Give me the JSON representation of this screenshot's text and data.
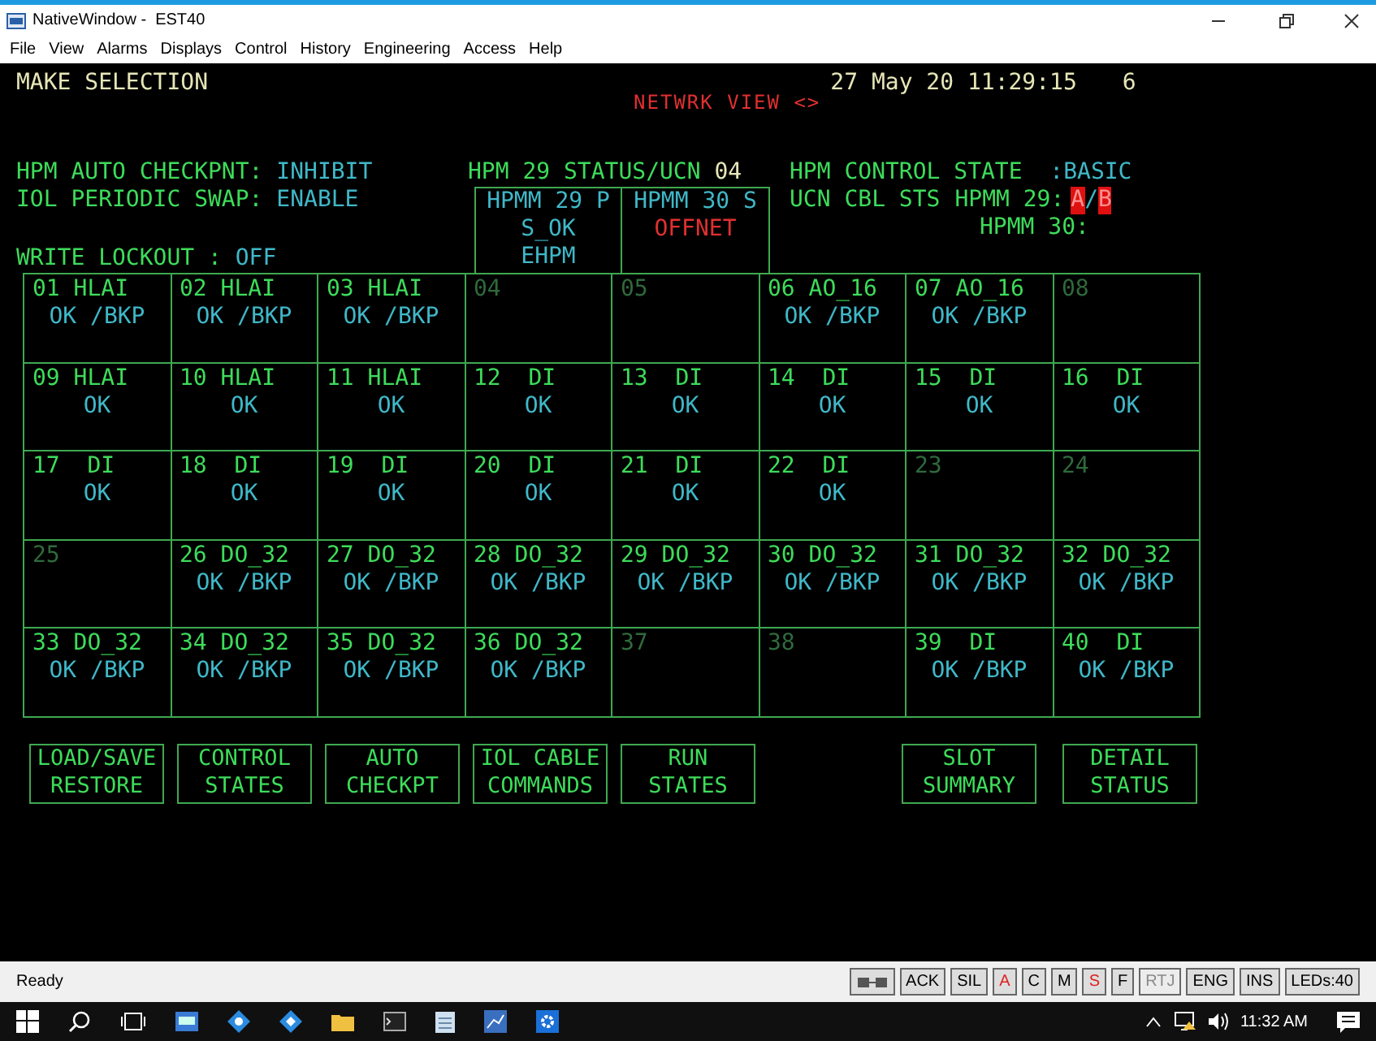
{
  "window": {
    "title": "NativeWindow -  EST40"
  },
  "menu": [
    "File",
    "View",
    "Alarms",
    "Displays",
    "Control",
    "History",
    "Engineering",
    "Access",
    "Help"
  ],
  "display": {
    "prompt": "MAKE SELECTION",
    "view_title": "NETWRK VIEW <>",
    "datetime": "27 May 20 11:29:15",
    "console_number": "6",
    "settings": [
      {
        "label": "HPM AUTO CHECKPNT:",
        "value": "INHIBIT"
      },
      {
        "label": "IOL PERIODIC SWAP:",
        "value": "ENABLE"
      },
      {
        "label": "WRITE LOCKOUT :",
        "value": "OFF"
      }
    ],
    "hpm_status": {
      "label": "HPM 29 STATUS/UCN",
      "ucn": "04",
      "hpmm": [
        {
          "title": "HPMM 29 P",
          "lines": [
            {
              "text": "S_OK",
              "kind": "normal"
            },
            {
              "text": "EHPM",
              "kind": "normal"
            }
          ]
        },
        {
          "title": "HPMM 30 S",
          "lines": [
            {
              "text": "OFFNET",
              "kind": "alarm"
            }
          ]
        }
      ]
    },
    "control_state": {
      "label": "HPM CONTROL STATE",
      "value": ":BASIC"
    },
    "cable_status": {
      "label": "UCN CBL STS",
      "hpmm_29": {
        "label": "HPMM 29:",
        "cable_a": {
          "text": "A",
          "alarm": true
        },
        "separator": "/",
        "cable_b": {
          "text": "B",
          "alarm": true
        }
      },
      "hpmm_30": {
        "label": "HPMM 30:"
      }
    },
    "slots": [
      {
        "number": "01",
        "type": "HLAI",
        "status": "OK /BKP",
        "kind": "module"
      },
      {
        "number": "02",
        "type": "HLAI",
        "status": "OK /BKP",
        "kind": "module"
      },
      {
        "number": "03",
        "type": "HLAI",
        "status": "OK /BKP",
        "kind": "module"
      },
      {
        "number": "04",
        "kind": "empty"
      },
      {
        "number": "05",
        "kind": "empty"
      },
      {
        "number": "06",
        "type": "AO_16",
        "status": "OK /BKP",
        "kind": "module"
      },
      {
        "number": "07",
        "type": "AO_16",
        "status": "OK /BKP",
        "kind": "module"
      },
      {
        "number": "08",
        "kind": "empty"
      },
      {
        "number": "09",
        "type": "HLAI",
        "status": "OK",
        "kind": "module"
      },
      {
        "number": "10",
        "type": "HLAI",
        "status": "OK",
        "kind": "module"
      },
      {
        "number": "11",
        "type": "HLAI",
        "status": "OK",
        "kind": "module"
      },
      {
        "number": "12",
        "type": " DI",
        "status": "OK",
        "kind": "module"
      },
      {
        "number": "13",
        "type": " DI",
        "status": "OK",
        "kind": "module"
      },
      {
        "number": "14",
        "type": " DI",
        "status": "OK",
        "kind": "module"
      },
      {
        "number": "15",
        "type": " DI",
        "status": "OK",
        "kind": "module"
      },
      {
        "number": "16",
        "type": " DI",
        "status": "OK",
        "kind": "module"
      },
      {
        "number": "17",
        "type": " DI",
        "status": "OK",
        "kind": "module"
      },
      {
        "number": "18",
        "type": " DI",
        "status": "OK",
        "kind": "module"
      },
      {
        "number": "19",
        "type": " DI",
        "status": "OK",
        "kind": "module"
      },
      {
        "number": "20",
        "type": " DI",
        "status": "OK",
        "kind": "module"
      },
      {
        "number": "21",
        "type": " DI",
        "status": "OK",
        "kind": "module"
      },
      {
        "number": "22",
        "type": " DI",
        "status": "OK",
        "kind": "module"
      },
      {
        "number": "23",
        "kind": "empty"
      },
      {
        "number": "24",
        "kind": "empty"
      },
      {
        "number": "25",
        "kind": "empty"
      },
      {
        "number": "26",
        "type": "DO_32",
        "status": "OK /BKP",
        "kind": "module"
      },
      {
        "number": "27",
        "type": "DO_32",
        "status": "OK /BKP",
        "kind": "module"
      },
      {
        "number": "28",
        "type": "DO_32",
        "status": "OK /BKP",
        "kind": "module"
      },
      {
        "number": "29",
        "type": "DO_32",
        "status": "OK /BKP",
        "kind": "module"
      },
      {
        "number": "30",
        "type": "DO_32",
        "status": "OK /BKP",
        "kind": "module"
      },
      {
        "number": "31",
        "type": "DO_32",
        "status": "OK /BKP",
        "kind": "module"
      },
      {
        "number": "32",
        "type": "DO_32",
        "status": "OK /BKP",
        "kind": "module"
      },
      {
        "number": "33",
        "type": "DO_32",
        "status": "OK /BKP",
        "kind": "module"
      },
      {
        "number": "34",
        "type": "DO_32",
        "status": "OK /BKP",
        "kind": "module"
      },
      {
        "number": "35",
        "type": "DO_32",
        "status": "OK /BKP",
        "kind": "module"
      },
      {
        "number": "36",
        "type": "DO_32",
        "status": "OK /BKP",
        "kind": "module"
      },
      {
        "number": "37",
        "kind": "empty"
      },
      {
        "number": "38",
        "kind": "empty"
      },
      {
        "number": "39",
        "type": " DI",
        "status": "OK /BKP",
        "kind": "module"
      },
      {
        "number": "40",
        "type": " DI",
        "status": "OK /BKP",
        "kind": "module"
      }
    ],
    "function_keys": {
      "left": [
        {
          "lines": [
            "LOAD/SAVE",
            "RESTORE"
          ]
        },
        {
          "lines": [
            "CONTROL",
            "STATES"
          ]
        },
        {
          "lines": [
            "AUTO",
            "CHECKPT"
          ]
        },
        {
          "lines": [
            "IOL CABLE",
            "COMMANDS"
          ]
        },
        {
          "lines": [
            "RUN",
            "STATES"
          ]
        }
      ],
      "right": [
        {
          "lines": [
            "SLOT",
            "SUMMARY"
          ]
        },
        {
          "lines": [
            "DETAIL",
            "STATUS"
          ]
        }
      ]
    }
  },
  "status_bar": {
    "text": "Ready",
    "indicators": [
      {
        "text": "ACK",
        "kind": "normal"
      },
      {
        "text": "SIL",
        "kind": "normal"
      },
      {
        "text": "A",
        "kind": "alarm"
      },
      {
        "text": "C",
        "kind": "normal"
      },
      {
        "text": "M",
        "kind": "normal"
      },
      {
        "text": "S",
        "kind": "alarm"
      },
      {
        "text": "F",
        "kind": "normal"
      },
      {
        "text": "RTJ",
        "kind": "disabled"
      },
      {
        "text": "ENG",
        "kind": "normal"
      },
      {
        "text": "INS",
        "kind": "normal"
      },
      {
        "text": "LEDs:40",
        "kind": "normal"
      }
    ]
  },
  "taskbar": {
    "clock": "11:32 AM"
  }
}
